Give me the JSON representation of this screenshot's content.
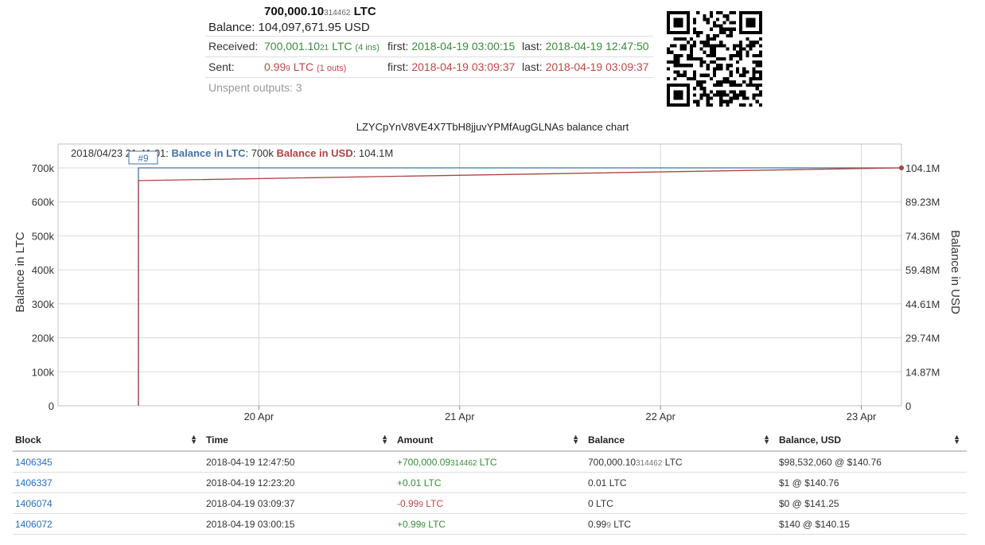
{
  "summary": {
    "balance_ltc_main": "700,000.10",
    "balance_ltc_small": "314462",
    "balance_ltc_unit": "LTC",
    "balance_label": "Balance:",
    "balance_usd": "104,097,671.95 USD",
    "received": {
      "label": "Received:",
      "amount_main": "700,001.10",
      "amount_small": "21",
      "unit": "LTC",
      "count": "(4 ins)",
      "first_label": "first:",
      "first": "2018-04-19 03:00:15",
      "last_label": "last:",
      "last": "2018-04-19 12:47:50"
    },
    "sent": {
      "label": "Sent:",
      "amount_main": "0.99",
      "amount_small": "9",
      "unit": "LTC",
      "count": "(1 outs)",
      "first_label": "first:",
      "first": "2018-04-19 03:09:37",
      "last_label": "last:",
      "last": "2018-04-19 03:09:37"
    },
    "unspent": "Unspent outputs: 3"
  },
  "qr": {
    "icon": "qr-code-icon"
  },
  "chart_data": {
    "type": "line",
    "title": "LZYCpYnV8VE4X7TbH8jjuvYPMfAugGLNAs balance chart",
    "ylabel": "Balance in LTC",
    "ylabel_right": "Balance in USD",
    "x_ticks": [
      "20 Apr",
      "21 Apr",
      "22 Apr",
      "23 Apr"
    ],
    "x_tick_days": [
      1,
      2,
      3,
      4
    ],
    "xlim_days": [
      0,
      4.2
    ],
    "y_ticks": [
      "0",
      "100k",
      "200k",
      "300k",
      "400k",
      "500k",
      "600k",
      "700k"
    ],
    "ylim": [
      0,
      700000
    ],
    "y2_ticks": [
      "0",
      "14.87M",
      "29.74M",
      "44.61M",
      "59.48M",
      "74.36M",
      "89.23M",
      "104.1M"
    ],
    "y2lim": [
      0,
      104100000
    ],
    "grid": true,
    "series": [
      {
        "name": "Balance in LTC",
        "color": "#4572a7",
        "axis": "left",
        "days": [
          0.4,
          0.4,
          4.2
        ],
        "values": [
          0,
          700000,
          700000
        ]
      },
      {
        "name": "Balance in USD",
        "color": "#aa4643",
        "axis": "right",
        "days": [
          0.4,
          0.4,
          4.2
        ],
        "values": [
          0,
          98532060,
          104097671.95
        ]
      }
    ],
    "tooltip": {
      "date": "2018/04/23 21:41:01:",
      "ltc_label": "Balance in LTC",
      "ltc_value": ": 700k",
      "usd_label": "Balance in USD",
      "usd_value": ": 104.1M"
    },
    "flag": "#9"
  },
  "table": {
    "headers": [
      "Block",
      "Time",
      "Amount",
      "Balance",
      "Balance, USD"
    ],
    "rows": [
      {
        "block": "1406345",
        "time": "2018-04-19 12:47:50",
        "amount": "+700,000.09",
        "amount_small": "314462",
        "amount_unit": "LTC",
        "amount_sign": "pos",
        "balance": "700,000.10",
        "balance_small": "314462",
        "balance_unit": "LTC",
        "usd": "$98,532,060 @ $140.76"
      },
      {
        "block": "1406337",
        "time": "2018-04-19 12:23:20",
        "amount": "+0.01",
        "amount_small": "",
        "amount_unit": "LTC",
        "amount_sign": "pos",
        "balance": "0.01",
        "balance_small": "",
        "balance_unit": "LTC",
        "usd": "$1 @ $140.76"
      },
      {
        "block": "1406074",
        "time": "2018-04-19 03:09:37",
        "amount": "-0.99",
        "amount_small": "9",
        "amount_unit": "LTC",
        "amount_sign": "neg",
        "balance": "0",
        "balance_small": "",
        "balance_unit": "LTC",
        "usd": "$0 @ $141.25"
      },
      {
        "block": "1406072",
        "time": "2018-04-19 03:00:15",
        "amount": "+0.99",
        "amount_small": "9",
        "amount_unit": "LTC",
        "amount_sign": "pos",
        "balance": "0.99",
        "balance_small": "9",
        "balance_unit": "LTC",
        "usd": "$140 @ $140.15"
      }
    ]
  }
}
